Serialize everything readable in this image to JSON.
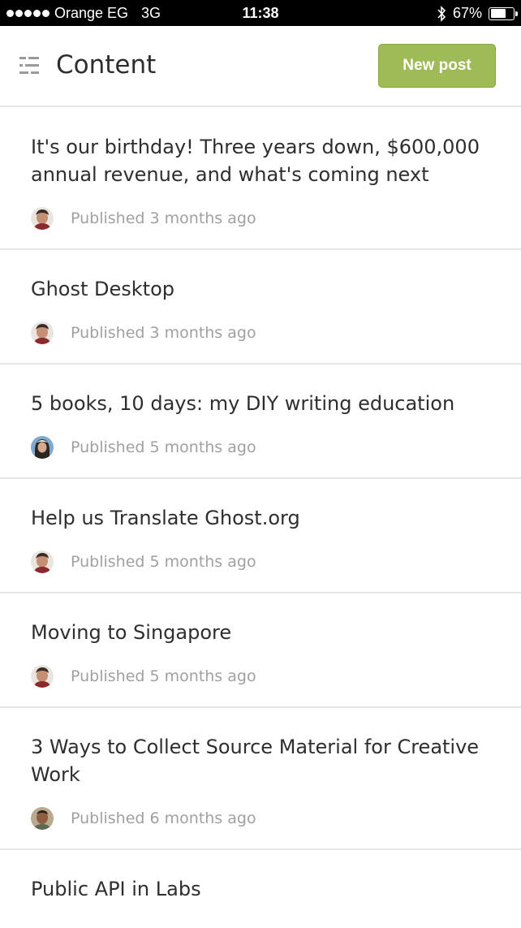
{
  "status_bar": {
    "carrier": "Orange EG",
    "network": "3G",
    "time": "11:38",
    "battery": "67%",
    "battery_level": 0.67
  },
  "header": {
    "title": "Content",
    "new_post_label": "New post",
    "accent_color": "#9fbb58"
  },
  "posts": [
    {
      "title": "It's our birthday! Three years down, $600,000 annual revenue, and what's coming next",
      "status": "Published 3 months ago",
      "avatar": "avatar-a"
    },
    {
      "title": "Ghost Desktop",
      "status": "Published 3 months ago",
      "avatar": "avatar-a"
    },
    {
      "title": "5 books, 10 days: my DIY writing education",
      "status": "Published 5 months ago",
      "avatar": "avatar-b"
    },
    {
      "title": "Help us Translate Ghost.org",
      "status": "Published 5 months ago",
      "avatar": "avatar-a"
    },
    {
      "title": "Moving to Singapore",
      "status": "Published 5 months ago",
      "avatar": "avatar-a"
    },
    {
      "title": "3 Ways to Collect Source Material for Creative Work",
      "status": "Published 6 months ago",
      "avatar": "avatar-c"
    },
    {
      "title": "Public API in Labs",
      "status": "",
      "avatar": ""
    }
  ]
}
